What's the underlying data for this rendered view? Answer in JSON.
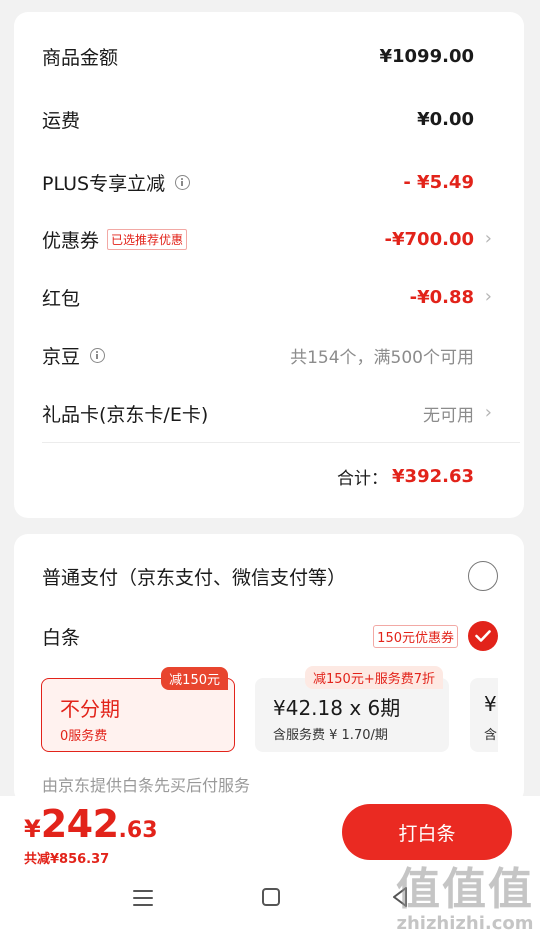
{
  "summary": {
    "rows": [
      {
        "label": "商品金额",
        "value": "¥1099.00"
      },
      {
        "label": "运费",
        "value": "¥0.00"
      },
      {
        "label": "PLUS专享立减",
        "value": "- ¥5.49"
      },
      {
        "label": "优惠券",
        "tag": "已选推荐优惠",
        "value": "-¥700.00"
      },
      {
        "label": "红包",
        "value": "-¥0.88"
      },
      {
        "label": "京豆",
        "value": "共154个，满500个可用"
      },
      {
        "label": "礼品卡(京东卡/E卡)",
        "value": "无可用"
      }
    ],
    "total_label": "合计：",
    "total_value": "¥392.63"
  },
  "payment": {
    "normal_label": "普通支付（京东支付、微信支付等）",
    "baitiao_label": "白条",
    "baitiao_coupon": "150元优惠券",
    "plans": [
      {
        "main": "不分期",
        "sub": "0服务费",
        "badge": "减150元"
      },
      {
        "main": "¥42.18 x 6期",
        "sub": "含服务费 ¥ 1.70/期",
        "badge": "减150元+服务费7折"
      },
      {
        "main": "¥",
        "sub": "含"
      }
    ],
    "service_note": "由京东提供白条先买后付服务"
  },
  "footer": {
    "price_symbol": "¥",
    "price_int": "242",
    "price_dec": ".63",
    "saved": "共减¥856.37",
    "pay_button": "打白条"
  },
  "watermark": {
    "big": "值值值",
    "small": "zhizhizhi.com"
  },
  "colors": {
    "accent": "#e2231a",
    "button": "#ea2a22"
  }
}
